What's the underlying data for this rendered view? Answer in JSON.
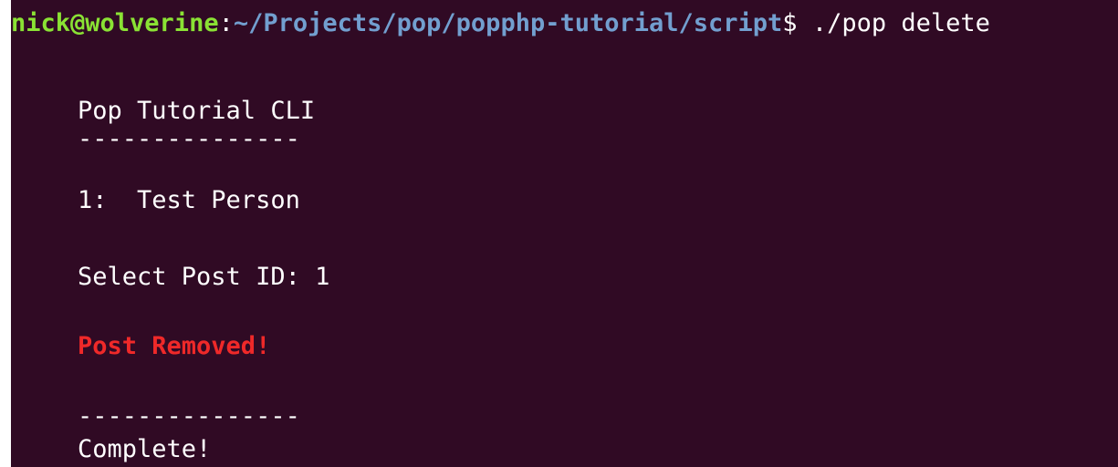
{
  "prompt": {
    "user_host": "nick@wolverine",
    "separator": ":",
    "path": "~/Projects/pop/popphp-tutorial/script",
    "symbol": "$",
    "command": " ./pop delete"
  },
  "output": {
    "title": "Pop Tutorial CLI",
    "divider_top": "---------------",
    "list_item": "1:  Test Person",
    "select_prompt": "Select Post ID: 1",
    "status_message": "Post Removed!",
    "divider_bottom": "---------------",
    "complete_message": "Complete!"
  },
  "colors": {
    "background": "#300a24",
    "text": "#ffffff",
    "user_host": "#8ae234",
    "path": "#729fcf",
    "error": "#ef2929"
  }
}
